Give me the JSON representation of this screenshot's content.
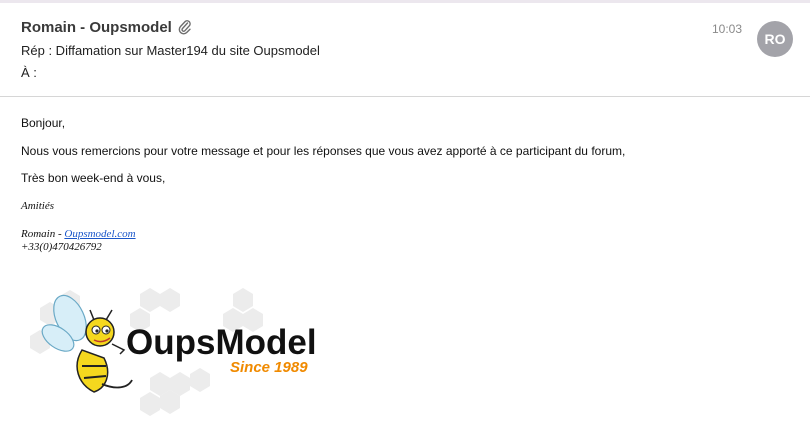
{
  "header": {
    "sender": "Romain - Oupsmodel",
    "time": "10:03",
    "avatar_initials": "RO",
    "subject": "Rép : Diffamation sur Master194 du site Oupsmodel",
    "to_label": "À :"
  },
  "body": {
    "greeting": "Bonjour,",
    "line1": "Nous vous remercions pour votre message et pour les réponses que vous avez apporté à ce participant du forum,",
    "line2": "Très bon week-end à vous,",
    "closing": "Amitiés",
    "sig_name": "Romain - ",
    "sig_link": "Oupsmodel.com",
    "sig_phone": "+33(0)470426792"
  },
  "logo": {
    "name": "OupsModel",
    "tagline": "Since 1989"
  },
  "colors": {
    "avatar": "#a3a3a9",
    "link": "#1a56c9",
    "logo_text": "#111111",
    "tagline": "#f08a00"
  }
}
